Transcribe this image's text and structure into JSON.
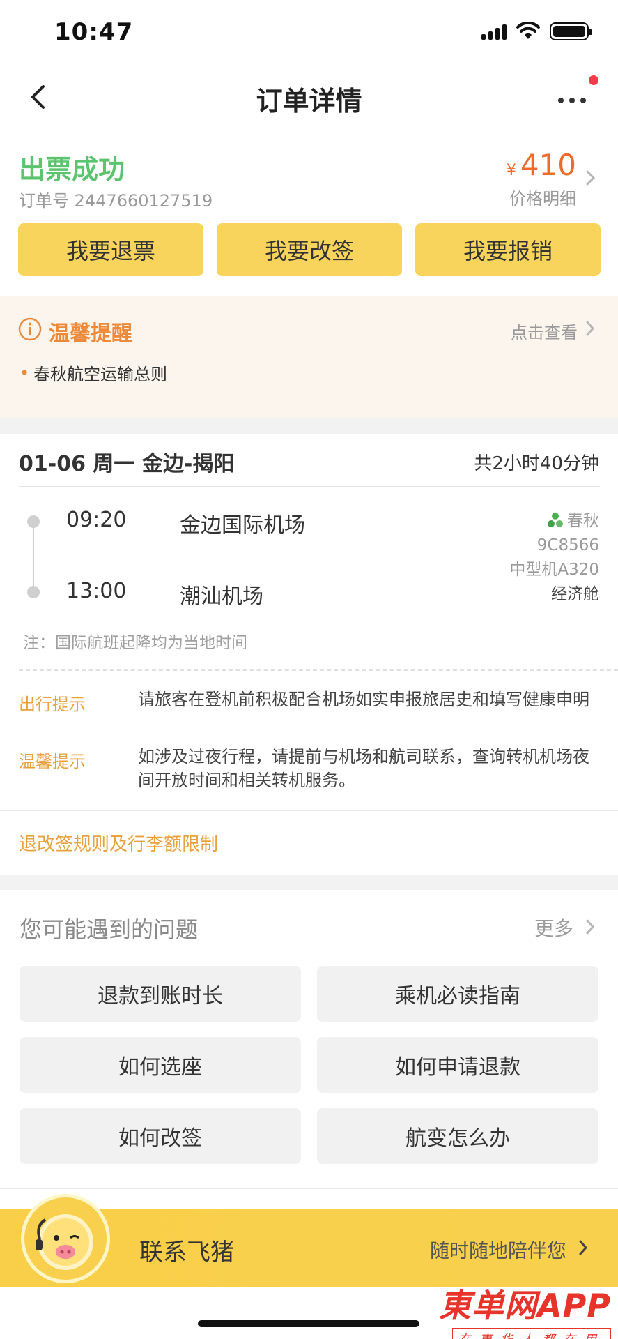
{
  "status_bar": {
    "time": "10:47"
  },
  "nav": {
    "title": "订单详情"
  },
  "order": {
    "status": "出票成功",
    "number": "订单号 2447660127519",
    "currency": "¥",
    "price": "410",
    "price_detail": "价格明细"
  },
  "actions": [
    "我要退票",
    "我要改签",
    "我要报销"
  ],
  "reminder": {
    "title": "温馨提醒",
    "link": "点击查看",
    "item": "春秋航空运输总则"
  },
  "flight": {
    "header": "01-06 周一 金边-揭阳",
    "duration": "共2小时40分钟",
    "dep_time": "09:20",
    "dep_airport": "金边国际机场",
    "arr_time": "13:00",
    "arr_airport": "潮汕机场",
    "airline": "春秋",
    "flight_no": "9C8566",
    "aircraft": "中型机A320",
    "cabin": "经济舱",
    "note": "注：国际航班起降均为当地时间"
  },
  "tips": [
    {
      "label": "出行提示",
      "text": "请旅客在登机前积极配合机场如实申报旅居史和填写健康申明"
    },
    {
      "label": "温馨提示",
      "text": "如涉及过夜行程，请提前与机场和航司联系，查询转机机场夜间开放时间和相关转机服务。"
    }
  ],
  "rules_link": "退改签规则及行李额限制",
  "faq": {
    "title": "您可能遇到的问题",
    "more": "更多",
    "items": [
      "退款到账时长",
      "乘机必读指南",
      "如何选座",
      "如何申请退款",
      "如何改签",
      "航变怎么办"
    ]
  },
  "contact": {
    "title": "联系飞猪",
    "slogan": "随时随地陪伴您"
  },
  "watermark": {
    "main": "東单网APP",
    "sub": "在東华人都在用"
  },
  "colors": {
    "accent_yellow": "#f8d45c",
    "success_green": "#5cc46f",
    "price_orange": "#f06a2a",
    "tip_orange": "#e8a13e"
  }
}
